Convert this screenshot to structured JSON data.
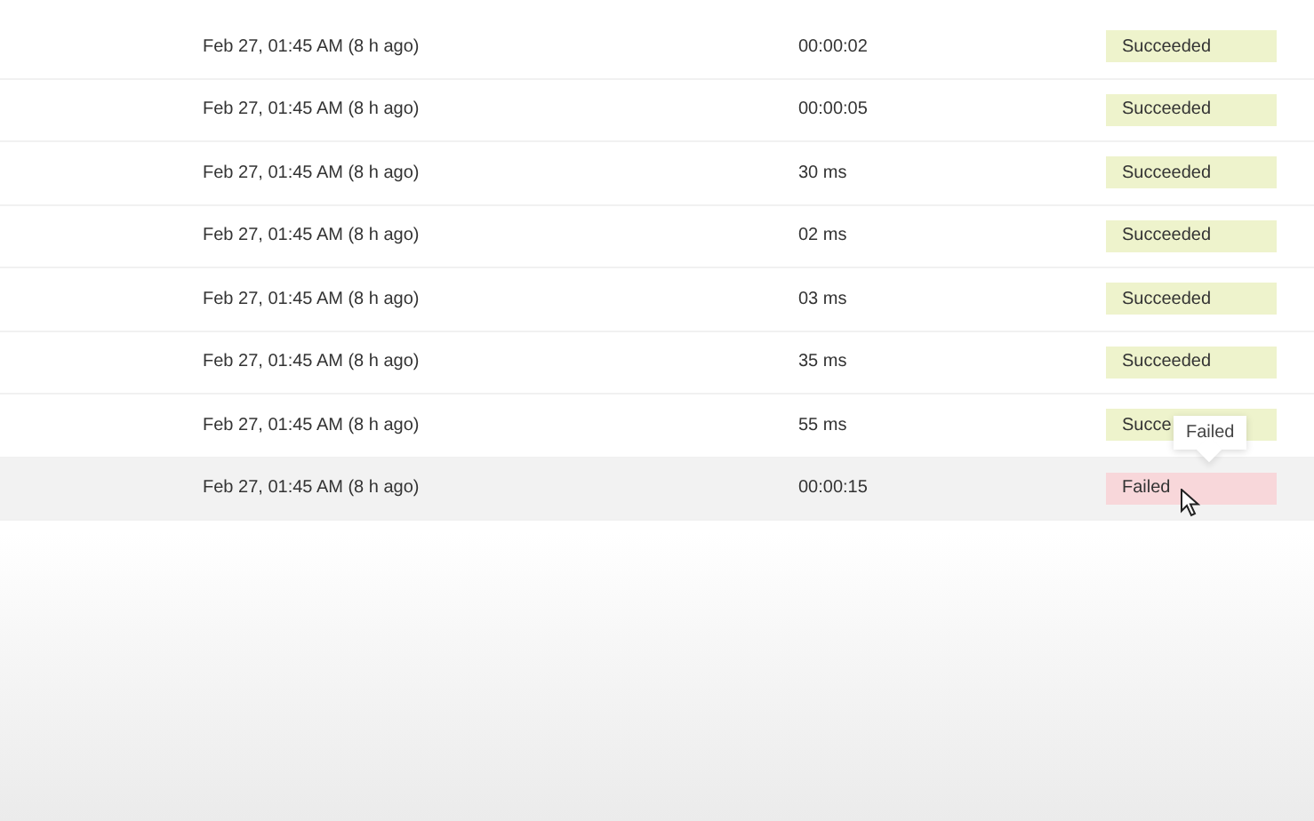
{
  "runs": [
    {
      "start": "Feb 27, 01:45 AM (8 h ago)",
      "duration": "00:00:02",
      "status": {
        "kind": "succeeded",
        "label": "Succeeded"
      },
      "selected": false
    },
    {
      "start": "Feb 27, 01:45 AM (8 h ago)",
      "duration": "00:00:05",
      "status": {
        "kind": "succeeded",
        "label": "Succeeded"
      },
      "selected": false
    },
    {
      "start": "Feb 27, 01:45 AM (8 h ago)",
      "duration": "30 ms",
      "status": {
        "kind": "succeeded",
        "label": "Succeeded"
      },
      "selected": false
    },
    {
      "start": "Feb 27, 01:45 AM (8 h ago)",
      "duration": "02 ms",
      "status": {
        "kind": "succeeded",
        "label": "Succeeded"
      },
      "selected": false
    },
    {
      "start": "Feb 27, 01:45 AM (8 h ago)",
      "duration": "03 ms",
      "status": {
        "kind": "succeeded",
        "label": "Succeeded"
      },
      "selected": false
    },
    {
      "start": "Feb 27, 01:45 AM (8 h ago)",
      "duration": "35 ms",
      "status": {
        "kind": "succeeded",
        "label": "Succeeded"
      },
      "selected": false
    },
    {
      "start": "Feb 27, 01:45 AM (8 h ago)",
      "duration": "55 ms",
      "status": {
        "kind": "succeeded",
        "label": "Succe"
      },
      "selected": false
    },
    {
      "start": "Feb 27, 01:45 AM (8 h ago)",
      "duration": "00:00:15",
      "status": {
        "kind": "failed",
        "label": "Failed"
      },
      "selected": true
    }
  ],
  "tooltip": {
    "text": "Failed"
  }
}
